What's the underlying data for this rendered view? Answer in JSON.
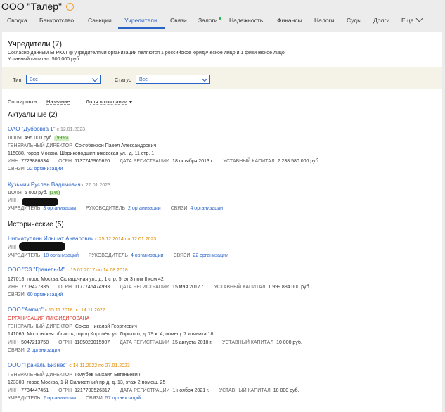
{
  "header": {
    "company": "ООО \"Талер\""
  },
  "tabs": [
    "Сводка",
    "Банкротство",
    "Санкции",
    "Учредители",
    "Связи",
    "Залоги",
    "Надежность",
    "Финансы",
    "Налоги",
    "Суды",
    "Долги",
    "Еще"
  ],
  "section": {
    "title": "Учредители (7)",
    "note1_a": "Согласно данным ЕГРЮЛ",
    "note1_b": "учредителями организации являются 1 российское юридическое лицо и 1 физическое лицо.",
    "note2": "Уставный капитал: 500 000 руб."
  },
  "filters": {
    "type_label": "Тип",
    "type_value": "Все",
    "status_label": "Статус",
    "status_value": "Все"
  },
  "sort": {
    "label": "Сортировка",
    "by_name": "Название",
    "by_share": "Доля в компании"
  },
  "actual": {
    "title": "Актуальные (2)",
    "dubrovka": {
      "name": "ОАО \"Дубровка 1\"",
      "since": "с 12.01.2023",
      "share_label": "ДОЛЯ",
      "share": "495 000 руб.",
      "share_pct": "(99%)",
      "director_label": "ГЕНЕРАЛЬНЫЙ ДИРЕКТОР",
      "director": "Сокгобензон Павел Александрович",
      "address": "115088, город Москва, Шарикоподшипниковская ул., д. 11 стр. 1",
      "inn_label": "ИНН",
      "inn": "7723886834",
      "ogrn_label": "ОГРН",
      "ogrn": "1137746965620",
      "reg_label": "ДАТА РЕГИСТРАЦИИ",
      "reg": "18 октября 2013 г.",
      "capital_label": "УСТАВНЫЙ КАПИТАЛ",
      "capital": "2 238 580 000 руб.",
      "links_label": "СВЯЗИ",
      "links": "22 организации"
    },
    "kuzmich": {
      "name": "Кузьмич Руслан Вадимович",
      "since": "с 27.01.2023",
      "share_label": "ДОЛЯ",
      "share": "5 000 руб.",
      "share_pct": "(1%)",
      "inn_label": "ИНН",
      "founder_label": "УЧРЕДИТЕЛЬ",
      "founder": "3 организации",
      "head_label": "РУКОВОДИТЕЛЬ",
      "head": "2 организации",
      "links_label": "СВЯЗИ",
      "links": "4 организации"
    }
  },
  "historical": {
    "title": "Исторические (5)",
    "nigmatullin": {
      "name": "Нигматуллин Ильшат Анварович",
      "period": "с 25.12.2014 по 12.01.2023",
      "inn_label": "ИНН",
      "founder_label": "УЧРЕДИТЕЛЬ",
      "founder": "18 организаций",
      "head_label": "РУКОВОДИТЕЛЬ",
      "head": "4 организации",
      "links_label": "СВЯЗИ",
      "links": "22 организации"
    },
    "granel_m": {
      "name": "ООО \"СЗ \"Гранель-М\"",
      "period": "с 19.07.2017 по 14.08.2018",
      "address": "127018, город Москва, Складочная ул., д. 1 стр. 5, эт 3 пом II ком 42",
      "inn_label": "ИНН",
      "inn": "7703427335",
      "ogrn_label": "ОГРН",
      "ogrn": "1177746474993",
      "reg_label": "ДАТА РЕГИСТРАЦИИ",
      "reg": "15 мая 2017 г.",
      "capital_label": "УСТАВНЫЙ КАПИТАЛ",
      "capital": "1 999 884 000 руб.",
      "links_label": "СВЯЗИ",
      "links": "60 организаций"
    },
    "ampir": {
      "name": "ООО \"Ампир\"",
      "period": "с 15.11.2018 по 14.11.2022",
      "status": "ОРГАНИЗАЦИЯ ЛИКВИДИРОВАНА",
      "director_label": "ГЕНЕРАЛЬНЫЙ ДИРЕКТОР",
      "director": "Соков Николай Георгиевич",
      "address": "141065, Московская область, город Королёв, ул. Горького, д. 79 к. 4, помещ. 7 комната 18",
      "inn_label": "ИНН",
      "inn": "5047213758",
      "ogrn_label": "ОГРН",
      "ogrn": "1185029015907",
      "reg_label": "ДАТА РЕГИСТРАЦИИ",
      "reg": "15 августа 2018 г.",
      "capital_label": "УСТАВНЫЙ КАПИТАЛ",
      "capital": "10 000 руб.",
      "links_label": "СВЯЗИ",
      "links": "2 организации"
    },
    "granel_biz": {
      "name": "ООО \"Гранель Бизнес\"",
      "period": "с 14.11.2022 по 27.01.2023",
      "director_label": "ГЕНЕРАЛЬНЫЙ ДИРЕКТОР",
      "director": "Голубев Михаил Евгеньевич",
      "address": "123308, город Москва, 1-Й Силикатный пр-д, д. 13, этаж 2 помещ. 25",
      "inn_label": "ИНН",
      "inn": "7734447451",
      "ogrn_label": "ОГРН",
      "ogrn": "1217700526317",
      "reg_label": "ДАТА РЕГИСТРАЦИИ",
      "reg": "1 ноября 2021 г.",
      "capital_label": "УСТАВНЫЙ КАПИТАЛ",
      "capital": "10 000 руб.",
      "founder_label": "УЧРЕДИТЕЛЬ",
      "founder": "2 организации",
      "links_label": "СВЯЗИ",
      "links": "57 организаций"
    }
  }
}
